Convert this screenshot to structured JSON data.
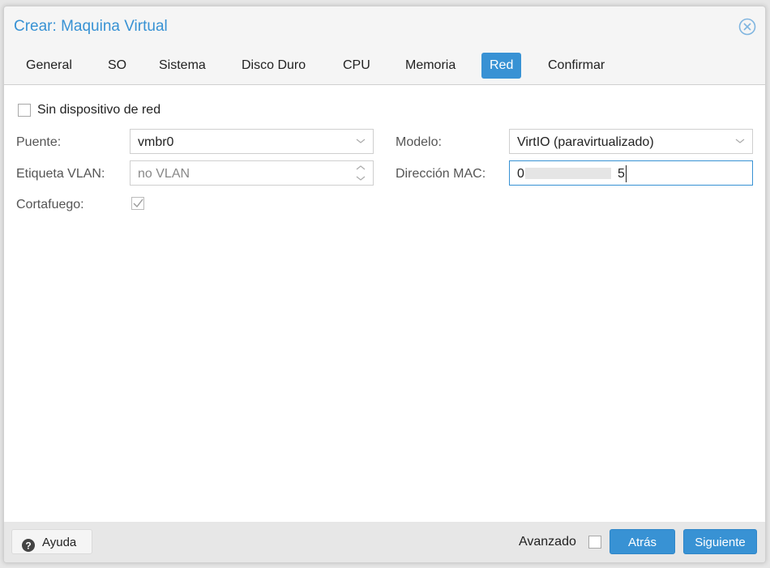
{
  "window": {
    "title": "Crear: Maquina Virtual",
    "close_icon": "close-circle-icon"
  },
  "tabs": [
    {
      "label": "General",
      "active": false
    },
    {
      "label": "SO",
      "active": false
    },
    {
      "label": "Sistema",
      "active": false
    },
    {
      "label": "Disco Duro",
      "active": false
    },
    {
      "label": "CPU",
      "active": false
    },
    {
      "label": "Memoria",
      "active": false
    },
    {
      "label": "Red",
      "active": true
    },
    {
      "label": "Confirmar",
      "active": false
    }
  ],
  "form": {
    "no_network": {
      "label": "Sin dispositivo de red",
      "checked": false
    },
    "bridge": {
      "label": "Puente:",
      "value": "vmbr0"
    },
    "vlan": {
      "label": "Etiqueta VLAN:",
      "placeholder": "no VLAN"
    },
    "firewall": {
      "label": "Cortafuego:",
      "checked": true
    },
    "model": {
      "label": "Modelo:",
      "value": "VirtIO (paravirtualizado)"
    },
    "mac": {
      "label": "Dirección MAC:",
      "value_start": "0",
      "value_end": "5"
    }
  },
  "footer": {
    "help_label": "Ayuda",
    "help_icon": "question-circle-icon",
    "advanced_label": "Avanzado",
    "advanced_checked": false,
    "back_label": "Atrás",
    "next_label": "Siguiente"
  },
  "colors": {
    "accent": "#3892d4"
  }
}
